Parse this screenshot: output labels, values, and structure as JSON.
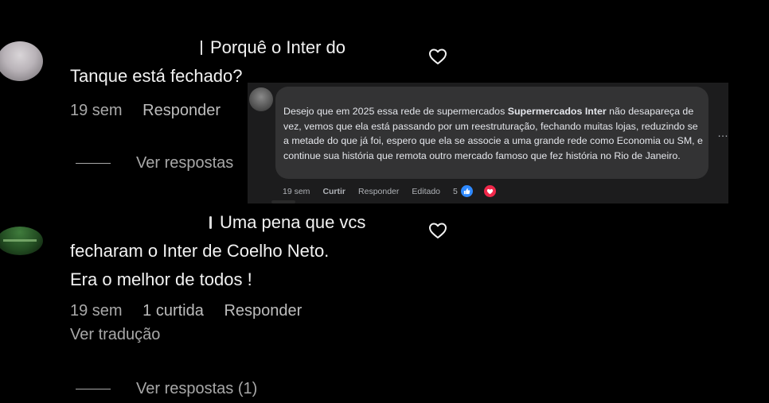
{
  "comment1": {
    "text_line1": "Porquê o Inter do",
    "text_line2": "Tanque está fechado?",
    "time": "19 sem",
    "reply_label": "Responder",
    "view_replies": "Ver respostas"
  },
  "comment2": {
    "text_line1": "Uma pena que vcs",
    "text_line2": "fecharam o Inter de Coelho Neto.",
    "text_line3": "Era o melhor de todos !",
    "time": "19 sem",
    "likes": "1 curtida",
    "reply_label": "Responder",
    "translate_label": "Ver tradução",
    "view_replies": "Ver respostas (1)"
  },
  "fb_comment": {
    "body_part1": "Desejo que em 2025 essa rede de supermercados ",
    "body_bold": "Supermercados Inter",
    "body_part2": " não desapareça de vez, vemos que ela está passando por um reestruturação, fechando muitas lojas, reduzindo se a metade do que já foi, espero que ela se associe a uma grande rede como Economia ou SM, e continue sua história que remota outro mercado famoso que fez história no Rio de Janeiro.",
    "more_icon": "…",
    "time": "19 sem",
    "like_label": "Curtir",
    "reply_label": "Responder",
    "edited_label": "Editado",
    "reaction_count": "5",
    "reactions": [
      "like-icon",
      "love-icon"
    ],
    "like_color": "#2e89ff",
    "love_color": "#f0284a"
  },
  "icons": {
    "heart": "heart-outline-icon"
  },
  "colors": {
    "background": "#000000",
    "primary_text": "#f2f2f2",
    "secondary_text": "#a8a8a8",
    "fb_bubble": "#333334"
  }
}
